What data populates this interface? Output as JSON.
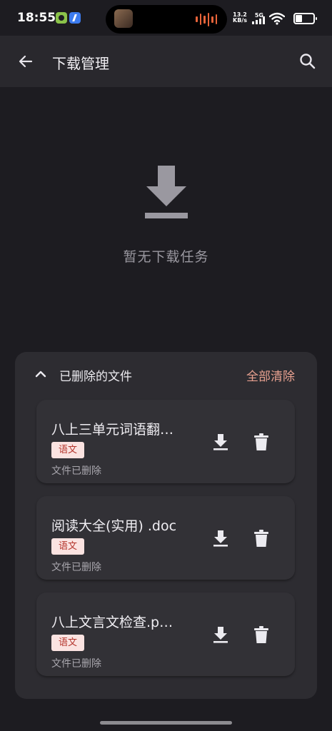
{
  "status_bar": {
    "time": "18:55",
    "net_speed_value": "13.2",
    "net_speed_unit": "KB/s",
    "network_type": "5G",
    "icons": [
      "app-notification-icon",
      "feishu-icon",
      "signal-icon",
      "wifi-icon",
      "battery-icon"
    ]
  },
  "toolbar": {
    "title": "下载管理",
    "back_icon": "arrow-left-icon",
    "search_icon": "search-icon"
  },
  "empty_state": {
    "icon": "download-icon",
    "text": "暂无下载任务"
  },
  "deleted_section": {
    "title": "已删除的文件",
    "clear_all_label": "全部清除",
    "collapse_icon": "chevron-up-icon",
    "files": [
      {
        "name": "八上三单元词语翻…",
        "tag": "语文",
        "status": "文件已删除"
      },
      {
        "name": "阅读大全(实用) .doc",
        "tag": "语文",
        "status": "文件已删除"
      },
      {
        "name": "八上文言文检查.p…",
        "tag": "语文",
        "status": "文件已删除"
      }
    ]
  },
  "colors": {
    "background": "#1d1c21",
    "toolbar": "#29282d",
    "panel": "#2d2c31",
    "card": "#323136",
    "accent": "#e7a08f",
    "tag_bg": "#fbe3e1",
    "tag_text": "#b4352c"
  }
}
